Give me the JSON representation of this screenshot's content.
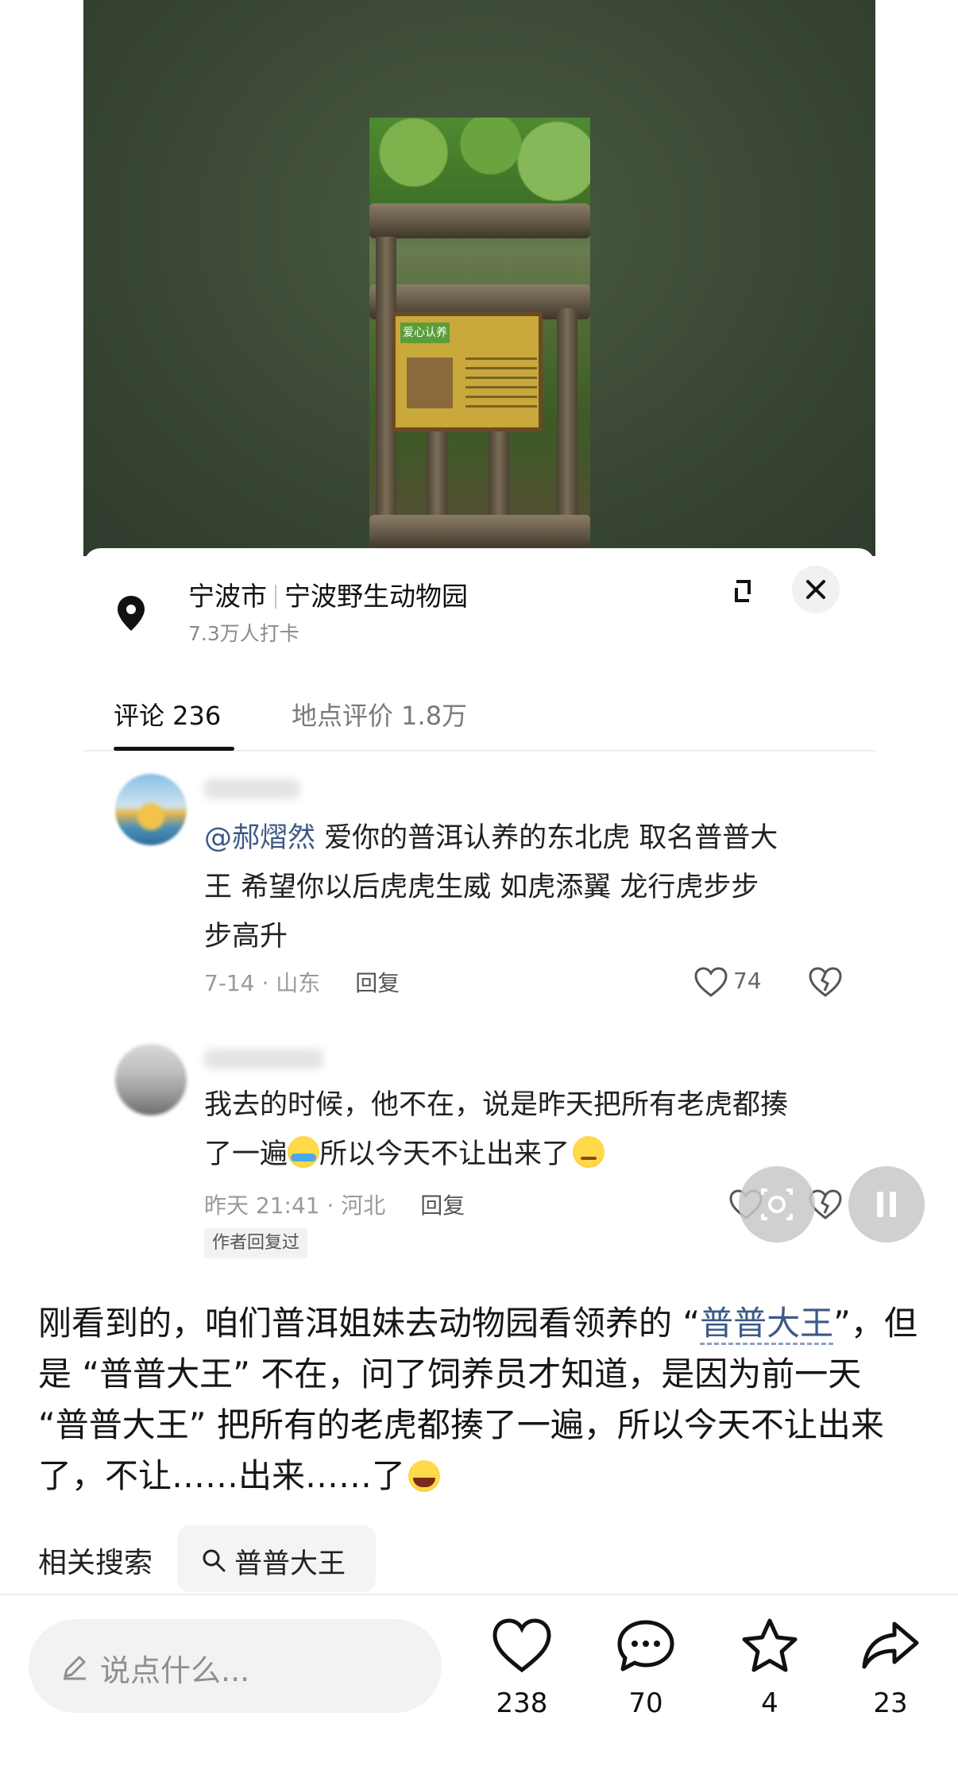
{
  "place": {
    "city": "宁波市",
    "name": "宁波野生动物园",
    "checkins": "7.3万人打卡"
  },
  "video": {
    "sign_tag": "爱心认养"
  },
  "tabs": [
    {
      "label": "评论 236",
      "active": true
    },
    {
      "label": "地点评价 1.8万",
      "active": false
    }
  ],
  "comments": [
    {
      "mention": "@郝熠然",
      "text_line1": " 爱你的普洱认养的东北虎  取名普普大",
      "text_line2": "王   希望你以后虎虎生威  如虎添翼  龙行虎步步",
      "text_line3": "步高升",
      "time_location": "7-14 · 山东",
      "reply_label": "回复",
      "likes": "74"
    },
    {
      "text_line1": "我去的时候，他不在，说是昨天把所有老虎都揍",
      "text_line2a": "了一遍",
      "text_line2b": "所以今天不让出来了",
      "time_location": "昨天 21:41 · 河北",
      "reply_label": "回复",
      "author_badge": "作者回复过"
    }
  ],
  "description": {
    "part1": "刚看到的，咱们普洱姐妹去动物园看领养的 “",
    "highlight": "普普大王",
    "part2": "”，但是 “普普大王” 不在，问了饲养员才知道，是因为前一天 “普普大王” 把所有的老虎都揍了一遍，所以今天不让出来了，不让……出来……了"
  },
  "related": {
    "label": "相关搜索",
    "query": "普普大王"
  },
  "bottom_bar": {
    "input_placeholder": "说点什么...",
    "likes": "238",
    "comments": "70",
    "favorites": "4",
    "shares": "23"
  },
  "colors": {
    "mention": "#3c5a86",
    "video_bg": "#3b4a36"
  }
}
